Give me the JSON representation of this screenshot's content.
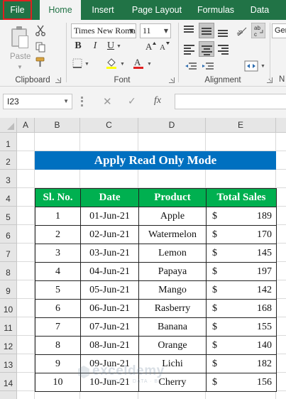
{
  "ribbon": {
    "tabs": [
      "File",
      "Home",
      "Insert",
      "Page Layout",
      "Formulas",
      "Data"
    ],
    "groups": {
      "clipboard": "Clipboard",
      "font": "Font",
      "alignment": "Alignment"
    },
    "paste_label": "Paste",
    "font_name": "Times New Roman",
    "font_size": "11",
    "partial_combo": "Gen",
    "partial_label": "N"
  },
  "formula_bar": {
    "name_box": "I23",
    "fx": "fx"
  },
  "columns": [
    "A",
    "B",
    "C",
    "D",
    "E"
  ],
  "rows": [
    "1",
    "2",
    "3",
    "4",
    "5",
    "6",
    "7",
    "8",
    "9",
    "10",
    "11",
    "12",
    "13",
    "14"
  ],
  "sheet": {
    "title": "Apply Read Only Mode",
    "headers": [
      "Sl. No.",
      "Date",
      "Product",
      "Total Sales"
    ],
    "records": [
      {
        "sl": "1",
        "date": "01-Jun-21",
        "product": "Apple",
        "currency": "$",
        "sales": "189"
      },
      {
        "sl": "2",
        "date": "02-Jun-21",
        "product": "Watermelon",
        "currency": "$",
        "sales": "170"
      },
      {
        "sl": "3",
        "date": "03-Jun-21",
        "product": "Lemon",
        "currency": "$",
        "sales": "145"
      },
      {
        "sl": "4",
        "date": "04-Jun-21",
        "product": "Papaya",
        "currency": "$",
        "sales": "197"
      },
      {
        "sl": "5",
        "date": "05-Jun-21",
        "product": "Mango",
        "currency": "$",
        "sales": "142"
      },
      {
        "sl": "6",
        "date": "06-Jun-21",
        "product": "Rasberry",
        "currency": "$",
        "sales": "168"
      },
      {
        "sl": "7",
        "date": "07-Jun-21",
        "product": "Banana",
        "currency": "$",
        "sales": "155"
      },
      {
        "sl": "8",
        "date": "08-Jun-21",
        "product": "Orange",
        "currency": "$",
        "sales": "140"
      },
      {
        "sl": "9",
        "date": "09-Jun-21",
        "product": "Lichi",
        "currency": "$",
        "sales": "182"
      },
      {
        "sl": "10",
        "date": "10-Jun-21",
        "product": "Cherry",
        "currency": "$",
        "sales": "156"
      }
    ]
  },
  "watermark": {
    "name": "exceldemy",
    "tagline": "EXCEL · DATA · BI"
  },
  "colors": {
    "excel_green": "#217346",
    "title_blue": "#0070c0",
    "header_green": "#00b050",
    "file_outline": "#e02020"
  },
  "icons": [
    "paste-icon",
    "cut-icon",
    "copy-icon",
    "format-painter-icon",
    "bold-icon",
    "italic-icon",
    "underline-icon",
    "borders-icon",
    "fill-color-icon",
    "font-color-icon",
    "align-icon",
    "orientation-icon",
    "wrap-text-icon",
    "merge-icon",
    "cancel-icon",
    "enter-icon",
    "fx-icon"
  ]
}
